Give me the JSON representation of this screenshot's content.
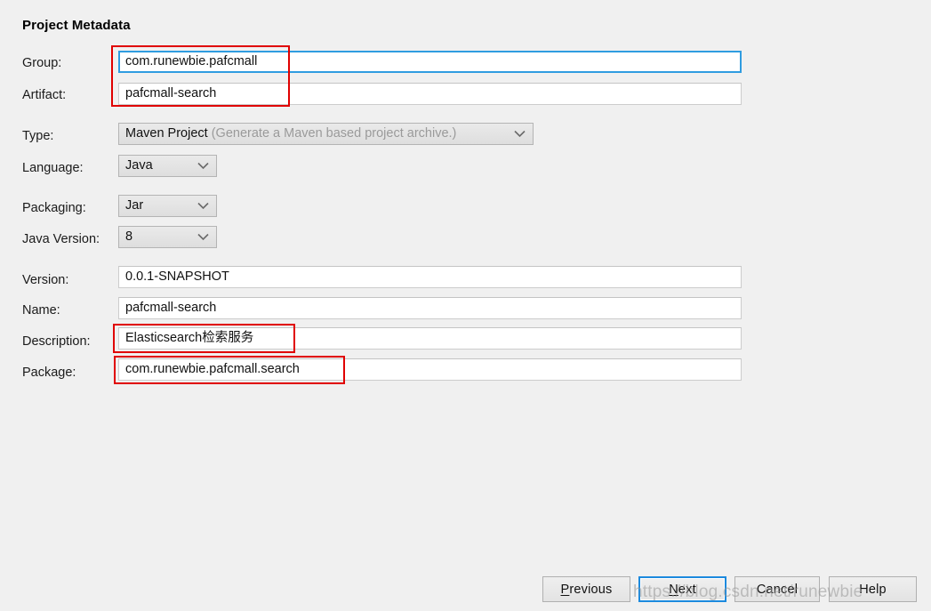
{
  "heading": "Project Metadata",
  "fields": {
    "group": {
      "label": "Group:",
      "value": "com.runewbie.pafcmall",
      "focused": true
    },
    "artifact": {
      "label": "Artifact:",
      "value": "pafcmall-search"
    },
    "type": {
      "label": "Type:",
      "value": "Maven Project",
      "hint": "(Generate a Maven based project archive.)"
    },
    "language": {
      "label": "Language:",
      "value": "Java"
    },
    "packaging": {
      "label": "Packaging:",
      "value": "Jar"
    },
    "java_version": {
      "label": "Java Version:",
      "value": "8"
    },
    "version": {
      "label": "Version:",
      "value": "0.0.1-SNAPSHOT"
    },
    "name": {
      "label": "Name:",
      "value": "pafcmall-search"
    },
    "description": {
      "label": "Description:",
      "value": "Elasticsearch检索服务"
    },
    "package": {
      "label": "Package:",
      "value": "com.runewbie.pafcmall.search"
    }
  },
  "buttons": {
    "previous": {
      "mnemonic": "P",
      "rest": "revious"
    },
    "next": {
      "mnemonic": "N",
      "rest": "ext"
    },
    "cancel": {
      "label": "Cancel"
    },
    "help": {
      "label": "Help"
    }
  },
  "watermark": "https://blog.csdn.net/runewbie",
  "colors": {
    "background": "#f0f0f0",
    "focus_blue": "#2f9ce0",
    "annotation_red": "#e00000",
    "field_white": "#ffffff"
  }
}
